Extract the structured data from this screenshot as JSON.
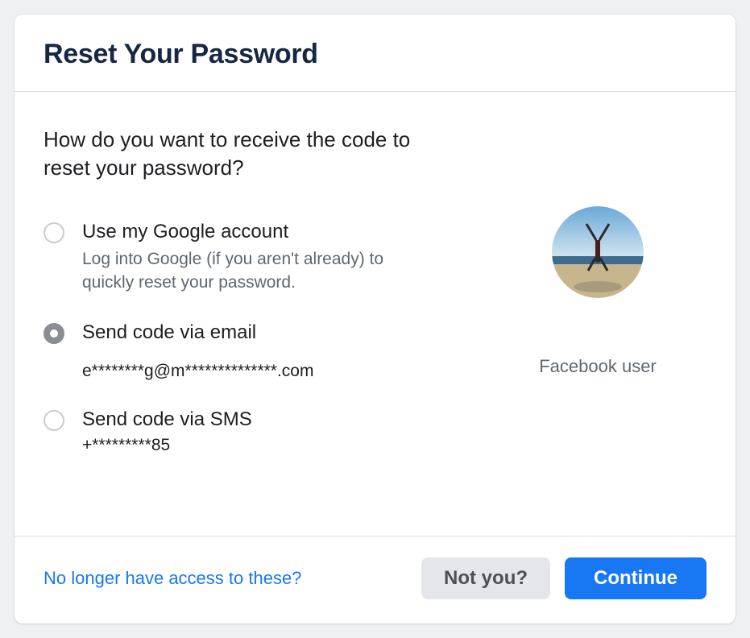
{
  "header": {
    "title": "Reset Your Password"
  },
  "prompt": "How do you want to receive the code to reset your password?",
  "options": [
    {
      "label": "Use my Google account",
      "description": "Log into Google (if you aren't already) to quickly reset your password.",
      "selected": false
    },
    {
      "label": "Send code via email",
      "detail": "e********g@m**************.com",
      "selected": true
    },
    {
      "label": "Send code via SMS",
      "detail": "+*********85",
      "selected": false
    }
  ],
  "user": {
    "label": "Facebook user"
  },
  "footer": {
    "no_access_link": "No longer have access to these?",
    "not_you": "Not you?",
    "continue": "Continue"
  }
}
